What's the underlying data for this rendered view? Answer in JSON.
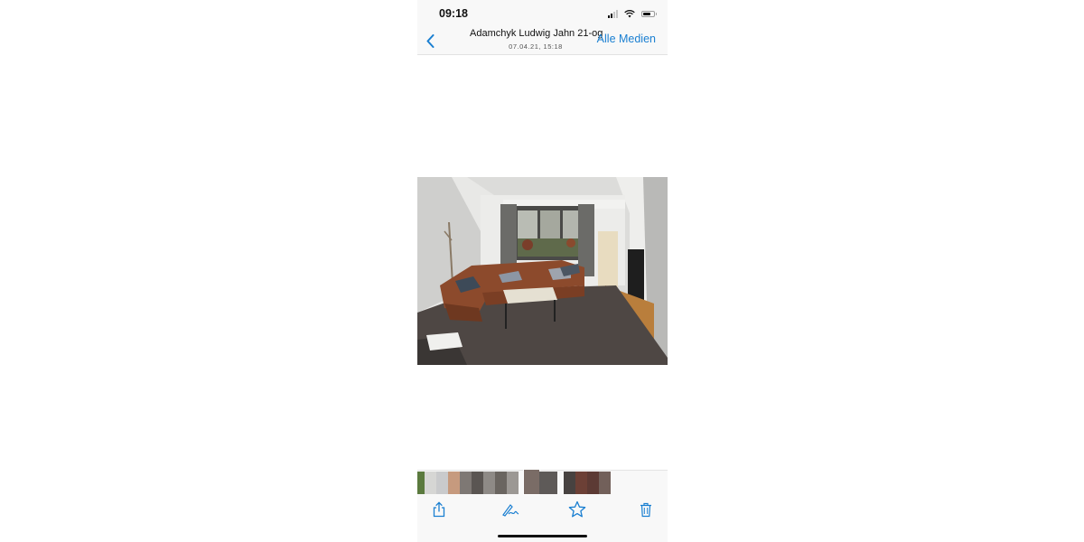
{
  "status_bar": {
    "time": "09:18",
    "icons": [
      "signal-icon",
      "wifi-icon",
      "battery-icon"
    ]
  },
  "nav": {
    "back_icon": "chevron-left-icon",
    "title": "Adamchyk Ludwig Jahn 21-og",
    "subtitle": "07.04.21, 15:18",
    "all_media_label": "Alle Medien"
  },
  "photo": {
    "description_icon": "living-room-photo"
  },
  "thumbnails": {
    "count": 16
  },
  "toolbar": {
    "items": [
      "share-icon",
      "markup-icon",
      "favorite-star-icon",
      "trash-icon"
    ]
  },
  "colors": {
    "accent": "#1a7fd1",
    "bar_background": "#f8f8f8"
  }
}
